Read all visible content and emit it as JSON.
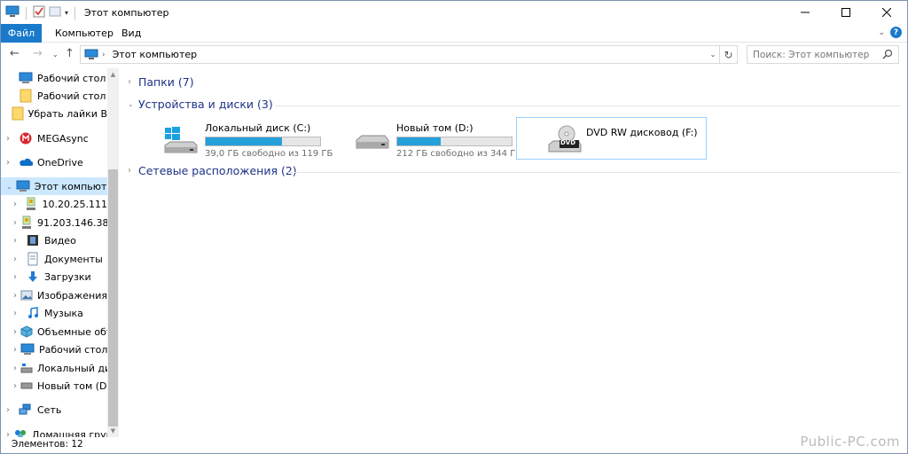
{
  "window": {
    "title": "Этот компьютер"
  },
  "ribbon": {
    "tabs": [
      "Файл",
      "Компьютер",
      "Вид"
    ]
  },
  "address": {
    "path": "Этот компьютер"
  },
  "search": {
    "placeholder": "Поиск: Этот компьютер"
  },
  "nav": {
    "items": [
      {
        "label": "Рабочий стол",
        "icon": "desktop-icon"
      },
      {
        "label": "Рабочий стол",
        "icon": "folder-icon"
      },
      {
        "label": "Убрать лайки В",
        "icon": "folder-icon"
      },
      {
        "label": "MEGAsync",
        "icon": "mega-icon"
      },
      {
        "label": "OneDrive",
        "icon": "onedrive-icon"
      },
      {
        "label": "Этот компьютер",
        "icon": "computer-icon"
      },
      {
        "label": "10.20.25.111",
        "icon": "network-drive-icon"
      },
      {
        "label": "91.203.146.38",
        "icon": "network-drive-icon"
      },
      {
        "label": "Видео",
        "icon": "video-icon"
      },
      {
        "label": "Документы",
        "icon": "documents-icon"
      },
      {
        "label": "Загрузки",
        "icon": "downloads-icon"
      },
      {
        "label": "Изображения",
        "icon": "pictures-icon"
      },
      {
        "label": "Музыка",
        "icon": "music-icon"
      },
      {
        "label": "Объемные объ",
        "icon": "3d-objects-icon"
      },
      {
        "label": "Рабочий стол",
        "icon": "desktop-icon"
      },
      {
        "label": "Локальный дис",
        "icon": "local-disk-icon"
      },
      {
        "label": "Новый том (D:)",
        "icon": "drive-icon"
      },
      {
        "label": "Сеть",
        "icon": "network-icon"
      },
      {
        "label": "Домашняя групп",
        "icon": "homegroup-icon"
      }
    ]
  },
  "groups": {
    "folders": "Папки (7)",
    "devices": "Устройства и диски (3)",
    "network": "Сетевые расположения (2)"
  },
  "drives": [
    {
      "name": "Локальный диск (C:)",
      "free": "39,0 ГБ свободно из 119 ГБ",
      "used_fraction": 0.67
    },
    {
      "name": "Новый том (D:)",
      "free": "212 ГБ свободно из 344 ГБ",
      "used_fraction": 0.38
    }
  ],
  "dvd": {
    "name": "DVD RW дисковод (F:)",
    "badge": "DVD"
  },
  "status": {
    "items": "Элементов: 12"
  },
  "watermark": "Public-PC.com",
  "colors": {
    "accent": "#1979ca",
    "selection": "#cce8ff",
    "bar_fill": "#26a0da",
    "group_text": "#1e3287"
  }
}
